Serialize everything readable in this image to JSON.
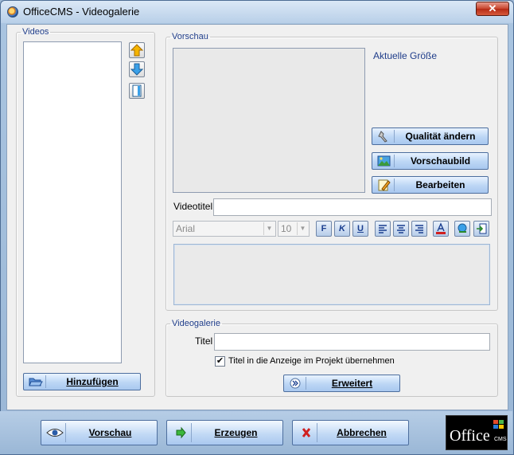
{
  "window": {
    "title": "OfficeCMS - Videogalerie",
    "close_glyph": "✕"
  },
  "videos_group": {
    "legend": "Videos",
    "icons": [
      "arrow-up-icon",
      "arrow-down-icon",
      "page-icon"
    ],
    "add_button": {
      "label": "Hinzufügen",
      "icon": "folder-open-icon"
    }
  },
  "preview_group": {
    "legend": "Vorschau",
    "current_size_label": "Aktuelle Größe",
    "buttons": [
      {
        "label": "Qualität ändern",
        "icon": "wrench-icon"
      },
      {
        "label": "Vorschaubild",
        "icon": "picture-icon"
      },
      {
        "label": "Bearbeiten",
        "icon": "pencil-icon"
      }
    ],
    "video_title_label": "Videotitel",
    "video_title_value": "",
    "font_family": "Arial",
    "font_size": "10",
    "format_buttons": [
      "F",
      "K",
      "U"
    ],
    "format_icons": [
      "align-left-icon",
      "align-center-icon",
      "align-right-icon",
      "text-color-icon",
      "link-icon",
      "insert-icon"
    ],
    "description_value": ""
  },
  "gallery_group": {
    "legend": "Videogalerie",
    "title_label": "Titel",
    "title_value": "",
    "checkbox_label": "Titel in die Anzeige im Projekt übernehmen",
    "checkbox_checked": true,
    "checkbox_glyph": "✔",
    "advanced_button": {
      "label": "Erweitert",
      "icon": "double-chevron-icon"
    }
  },
  "bottom_bar": {
    "buttons": [
      {
        "label": "Vorschau",
        "icon": "eye-icon"
      },
      {
        "label": "Erzeugen",
        "icon": "green-arrow-icon"
      },
      {
        "label": "Abbrechen",
        "icon": "red-x-icon"
      }
    ],
    "logo_word": "Office",
    "logo_sub": "CMS"
  },
  "colors": {
    "legend_text": "#1f3d8a",
    "button_gradient_top": "#e9f3ff",
    "button_gradient_bottom": "#a9c8ef",
    "close_red": "#c7442c"
  }
}
